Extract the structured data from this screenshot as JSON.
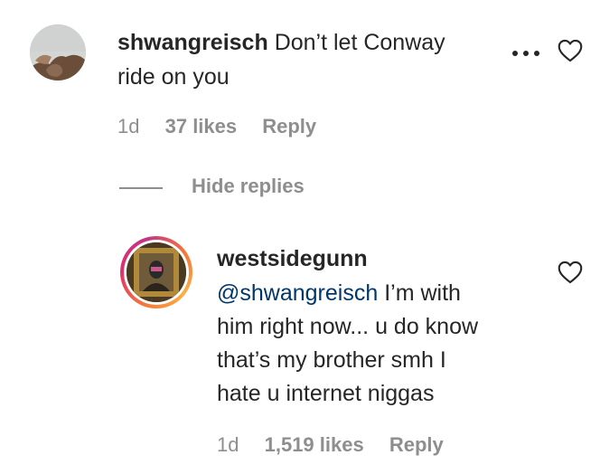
{
  "comment": {
    "username": "shwangreisch",
    "text_line1": "Don’t let Conway",
    "text_line2": "ride on you",
    "time": "1d",
    "likes": "37 likes",
    "reply_label": "Reply"
  },
  "hide_replies_label": "Hide replies",
  "reply": {
    "username": "westsidegunn",
    "mention": "@shwangreisch",
    "text_lines": [
      "I’m with",
      "him right now... u do know",
      "that’s my brother smh I",
      "hate u internet niggas"
    ],
    "time": "1d",
    "likes": "1,519 likes",
    "reply_label": "Reply"
  },
  "icons": {
    "more": "more-options-icon",
    "like": "heart-icon"
  },
  "colors": {
    "text": "#262626",
    "muted": "#8e8e8e",
    "mention": "#00376b",
    "story_ring": [
      "#fcaf45",
      "#f77737",
      "#e1306c",
      "#c13584"
    ]
  }
}
